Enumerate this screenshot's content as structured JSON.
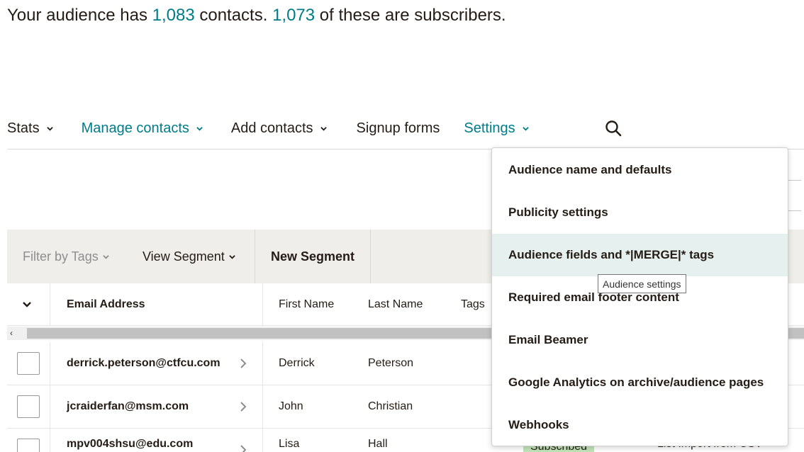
{
  "summary": {
    "prefix": "Your audience has ",
    "contacts_count": "1,083",
    "middle": " contacts. ",
    "subscribers_count": "1,073",
    "suffix": " of these are subscribers."
  },
  "nav": {
    "stats": "Stats",
    "manage_contacts": "Manage contacts",
    "add_contacts": "Add contacts",
    "signup_forms": "Signup forms",
    "settings": "Settings"
  },
  "toolbar": {
    "filter_by_tags": "Filter by Tags",
    "view_segment": "View Segment",
    "new_segment": "New Segment"
  },
  "table": {
    "columns": {
      "email": "Email Address",
      "first_name": "First Name",
      "last_name": "Last Name",
      "tags": "Tags"
    },
    "rows": [
      {
        "email": "derrick.peterson@ctfcu.com",
        "first_name": "Derrick",
        "last_name": "Peterson"
      },
      {
        "email": "jcraiderfan@msm.com",
        "first_name": "John",
        "last_name": "Christian"
      },
      {
        "email": "mpv004shsu@edu.com",
        "first_name": "Lisa",
        "last_name": "Hall",
        "status": "Subscribed",
        "source": "List Import from CSV"
      }
    ]
  },
  "settings_menu": {
    "items": [
      "Audience name and defaults",
      "Publicity settings",
      "Audience fields and *|MERGE|* tags",
      "Required email footer content",
      "Email Beamer",
      "Google Analytics on archive/audience pages",
      "Webhooks"
    ],
    "hovered_index": 2
  },
  "tooltip": "Audience settings",
  "colors": {
    "accent": "#007c89",
    "toolbar_bg": "#efeeea",
    "hover_bg": "#e6f0ef",
    "subscribed_badge": "#c1e3b8"
  },
  "icons": {
    "search": "search-icon",
    "chevron": "chevron-down-icon",
    "row_chevron": "chevron-right-icon"
  }
}
